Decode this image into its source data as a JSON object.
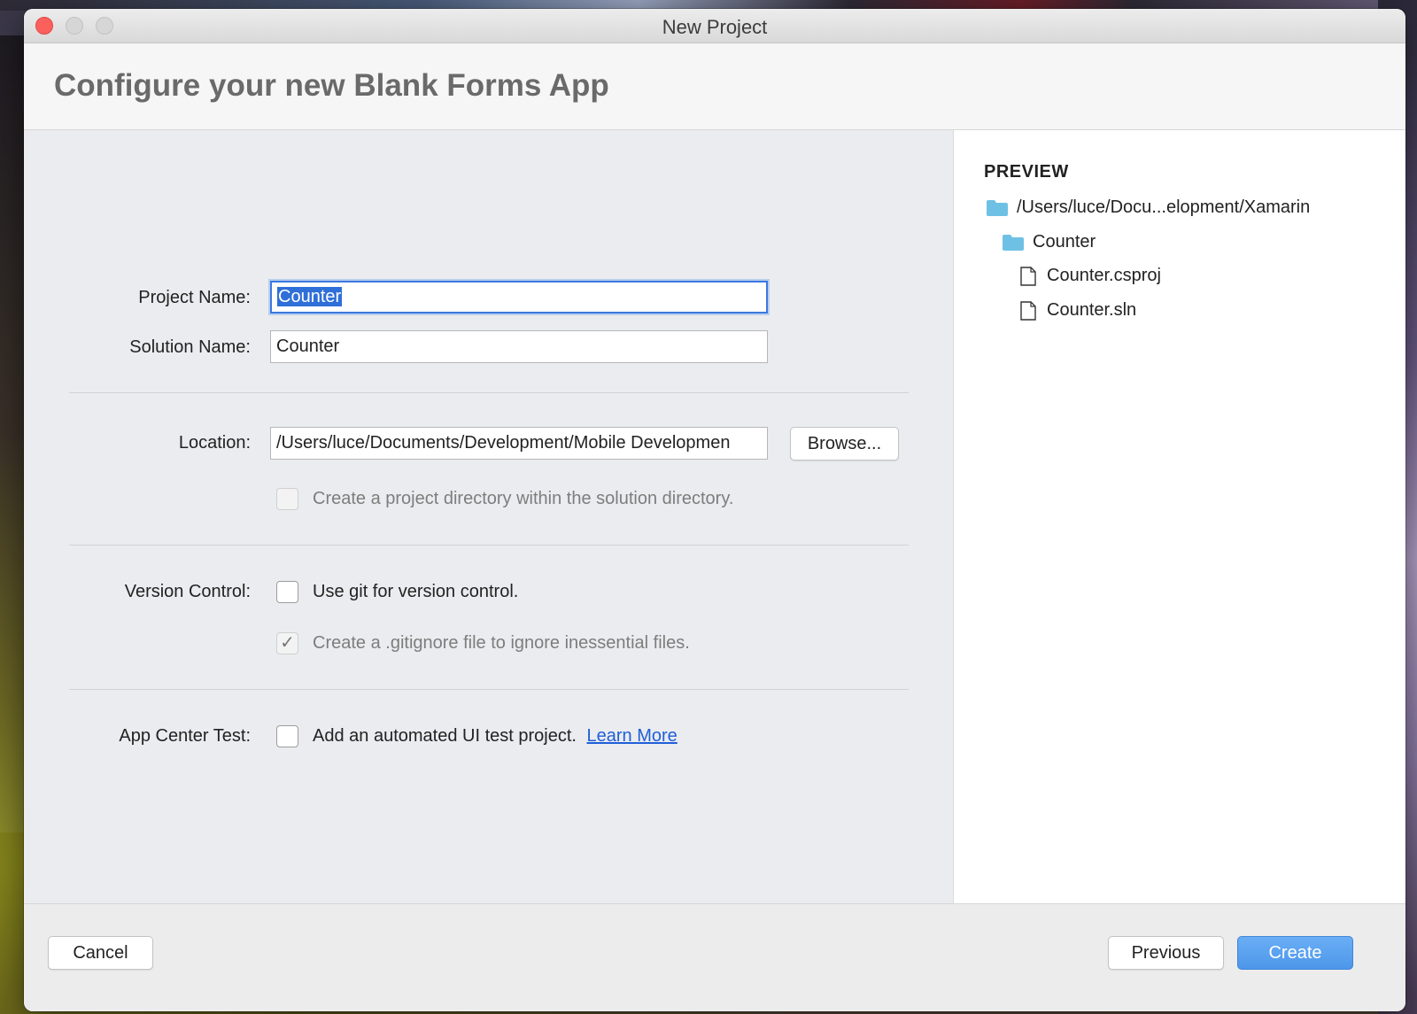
{
  "window": {
    "title": "New Project"
  },
  "header": {
    "title": "Configure your new Blank Forms App"
  },
  "form": {
    "project_name_label": "Project Name:",
    "project_name_value": "Counter",
    "solution_name_label": "Solution Name:",
    "solution_name_value": "Counter",
    "location_label": "Location:",
    "location_value": "/Users/luce/Documents/Development/Mobile Developmen",
    "browse_label": "Browse...",
    "project_directory_checkbox": {
      "label": "Create a project directory within the solution directory.",
      "checked": false,
      "enabled": false
    },
    "version_control_label": "Version Control:",
    "use_git_checkbox": {
      "label": "Use git for version control.",
      "checked": false,
      "enabled": true
    },
    "gitignore_checkbox": {
      "label": "Create a .gitignore file to ignore inessential files.",
      "checked": true,
      "enabled": false
    },
    "app_center_label": "App Center Test:",
    "ui_test_checkbox": {
      "label": "Add an automated UI test project.",
      "checked": false,
      "enabled": true
    },
    "learn_more_link": "Learn More"
  },
  "preview": {
    "title": "PREVIEW",
    "tree": [
      {
        "type": "folder",
        "label": "/Users/luce/Docu...elopment/Xamarin",
        "depth": 0
      },
      {
        "type": "folder",
        "label": "Counter",
        "depth": 1
      },
      {
        "type": "file",
        "label": "Counter.csproj",
        "depth": 2
      },
      {
        "type": "file",
        "label": "Counter.sln",
        "depth": 2
      }
    ]
  },
  "footer": {
    "cancel_label": "Cancel",
    "previous_label": "Previous",
    "create_label": "Create"
  },
  "colors": {
    "accent": "#4d97ea",
    "selection": "#2f6fd8",
    "folder": "#6ec1e4",
    "link": "#1f5fd8"
  }
}
